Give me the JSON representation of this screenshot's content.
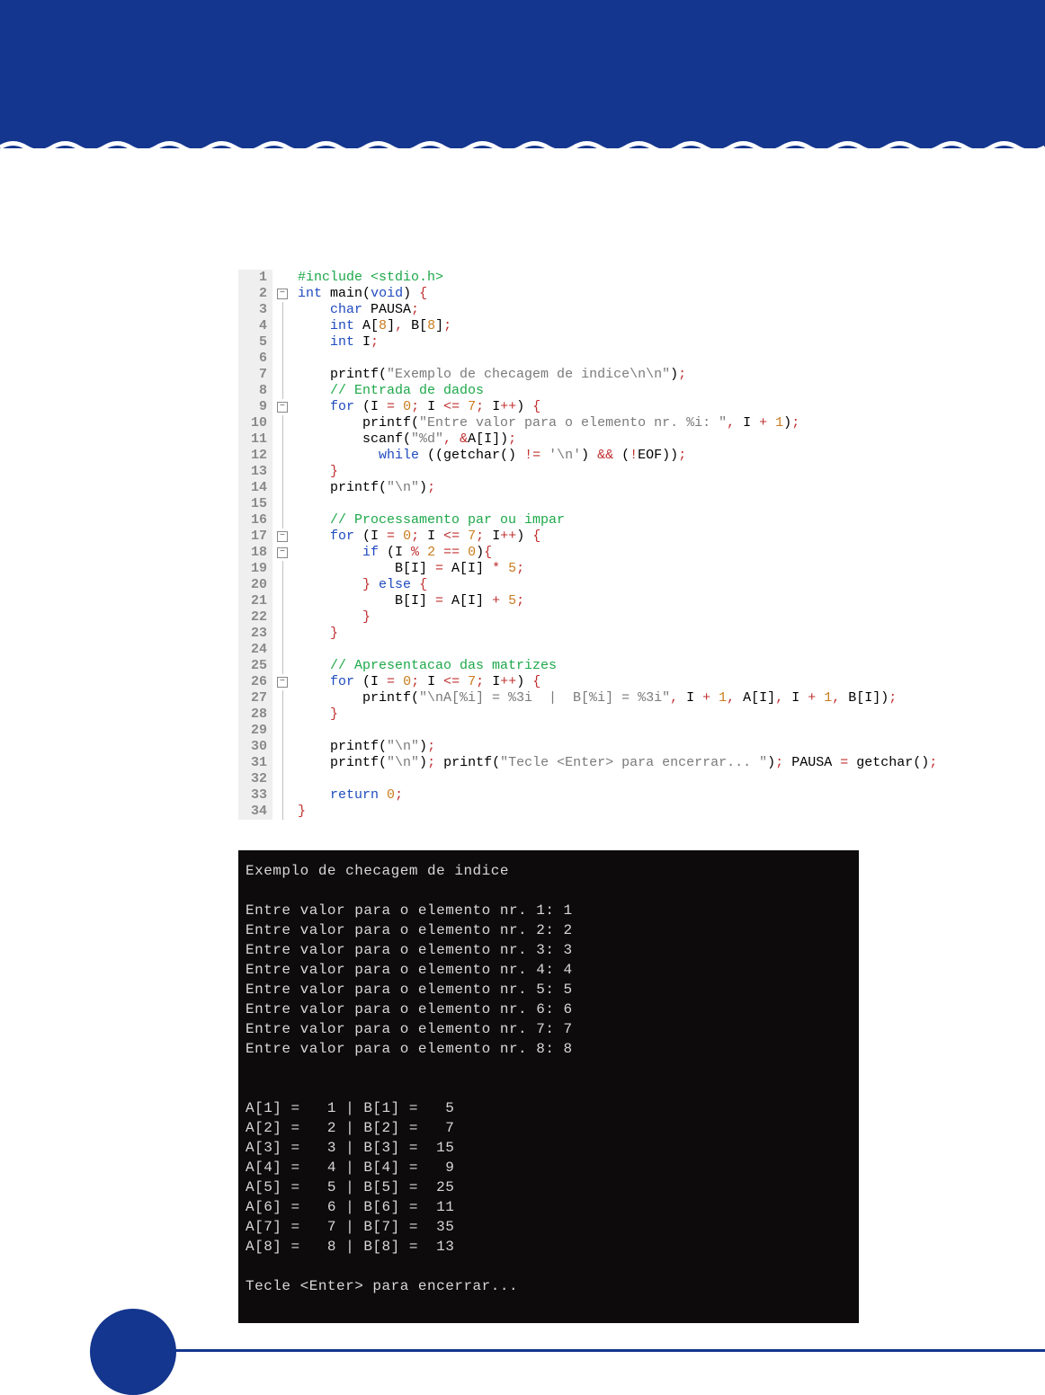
{
  "code_lines": [
    {
      "n": 1,
      "fold": "",
      "html": "<span class='c-pp'>#include &lt;stdio.h&gt;</span>"
    },
    {
      "n": 2,
      "fold": "box",
      "html": "<span class='c-kw'>int</span> <span class='c-fn'>main</span>(<span class='c-kw'>void</span>) <span class='c-op'>{</span>"
    },
    {
      "n": 3,
      "fold": "pipe",
      "html": "    <span class='c-kw'>char</span> PAUSA<span class='c-op'>;</span>"
    },
    {
      "n": 4,
      "fold": "pipe",
      "html": "    <span class='c-kw'>int</span> A[<span class='c-num'>8</span>]<span class='c-op'>,</span> B[<span class='c-num'>8</span>]<span class='c-op'>;</span>"
    },
    {
      "n": 5,
      "fold": "pipe",
      "html": "    <span class='c-kw'>int</span> I<span class='c-op'>;</span>"
    },
    {
      "n": 6,
      "fold": "pipe",
      "html": ""
    },
    {
      "n": 7,
      "fold": "pipe",
      "html": "    printf(<span class='c-str'>\"Exemplo de checagem de indice\\n\\n\"</span>)<span class='c-op'>;</span>"
    },
    {
      "n": 8,
      "fold": "pipe",
      "html": "    <span class='c-cm'>// Entrada de dados</span>"
    },
    {
      "n": 9,
      "fold": "box",
      "html": "    <span class='c-kw'>for</span> (I <span class='c-op'>=</span> <span class='c-num'>0</span><span class='c-op'>;</span> I <span class='c-op'>&lt;=</span> <span class='c-num'>7</span><span class='c-op'>;</span> I<span class='c-op'>++</span>) <span class='c-op'>{</span>"
    },
    {
      "n": 10,
      "fold": "pipe",
      "html": "        printf(<span class='c-str'>\"Entre valor para o elemento nr. %i: \"</span><span class='c-op'>,</span> I <span class='c-op'>+</span> <span class='c-num'>1</span>)<span class='c-op'>;</span>"
    },
    {
      "n": 11,
      "fold": "pipe",
      "html": "        scanf(<span class='c-str'>\"%d\"</span><span class='c-op'>,</span> <span class='c-op'>&amp;</span>A[I])<span class='c-op'>;</span>"
    },
    {
      "n": 12,
      "fold": "pipe",
      "html": "          <span class='c-kw'>while</span> ((getchar() <span class='c-op'>!=</span> <span class='c-str'>'\\n'</span>) <span class='c-op'>&amp;&amp;</span> (<span class='c-op'>!</span>EOF))<span class='c-op'>;</span>"
    },
    {
      "n": 13,
      "fold": "pipe",
      "html": "    <span class='c-op'>}</span>"
    },
    {
      "n": 14,
      "fold": "pipe",
      "html": "    printf(<span class='c-str'>\"\\n\"</span>)<span class='c-op'>;</span>"
    },
    {
      "n": 15,
      "fold": "pipe",
      "html": ""
    },
    {
      "n": 16,
      "fold": "pipe",
      "html": "    <span class='c-cm'>// Processamento par ou impar</span>"
    },
    {
      "n": 17,
      "fold": "box",
      "html": "    <span class='c-kw'>for</span> (I <span class='c-op'>=</span> <span class='c-num'>0</span><span class='c-op'>;</span> I <span class='c-op'>&lt;=</span> <span class='c-num'>7</span><span class='c-op'>;</span> I<span class='c-op'>++</span>) <span class='c-op'>{</span>"
    },
    {
      "n": 18,
      "fold": "box",
      "html": "        <span class='c-kw'>if</span> (I <span class='c-op'>%</span> <span class='c-num'>2</span> <span class='c-op'>==</span> <span class='c-num'>0</span>)<span class='c-op'>{</span>"
    },
    {
      "n": 19,
      "fold": "pipe",
      "html": "            B[I] <span class='c-op'>=</span> A[I] <span class='c-op'>*</span> <span class='c-num'>5</span><span class='c-op'>;</span>"
    },
    {
      "n": 20,
      "fold": "pipe",
      "html": "        <span class='c-op'>}</span> <span class='c-kw'>else</span> <span class='c-op'>{</span>"
    },
    {
      "n": 21,
      "fold": "pipe",
      "html": "            B[I] <span class='c-op'>=</span> A[I] <span class='c-op'>+</span> <span class='c-num'>5</span><span class='c-op'>;</span>"
    },
    {
      "n": 22,
      "fold": "pipe",
      "html": "        <span class='c-op'>}</span>"
    },
    {
      "n": 23,
      "fold": "pipe",
      "html": "    <span class='c-op'>}</span>"
    },
    {
      "n": 24,
      "fold": "pipe",
      "html": ""
    },
    {
      "n": 25,
      "fold": "pipe",
      "html": "    <span class='c-cm'>// Apresentacao das matrizes</span>"
    },
    {
      "n": 26,
      "fold": "box",
      "html": "    <span class='c-kw'>for</span> (I <span class='c-op'>=</span> <span class='c-num'>0</span><span class='c-op'>;</span> I <span class='c-op'>&lt;=</span> <span class='c-num'>7</span><span class='c-op'>;</span> I<span class='c-op'>++</span>) <span class='c-op'>{</span>"
    },
    {
      "n": 27,
      "fold": "pipe",
      "html": "        printf(<span class='c-str'>\"\\nA[%i] = %3i  |  B[%i] = %3i\"</span><span class='c-op'>,</span> I <span class='c-op'>+</span> <span class='c-num'>1</span><span class='c-op'>,</span> A[I]<span class='c-op'>,</span> I <span class='c-op'>+</span> <span class='c-num'>1</span><span class='c-op'>,</span> B[I])<span class='c-op'>;</span>"
    },
    {
      "n": 28,
      "fold": "pipe",
      "html": "    <span class='c-op'>}</span>"
    },
    {
      "n": 29,
      "fold": "pipe",
      "html": ""
    },
    {
      "n": 30,
      "fold": "pipe",
      "html": "    printf(<span class='c-str'>\"\\n\"</span>)<span class='c-op'>;</span>"
    },
    {
      "n": 31,
      "fold": "pipe",
      "html": "    printf(<span class='c-str'>\"\\n\"</span>)<span class='c-op'>;</span> printf(<span class='c-str'>\"Tecle &lt;Enter&gt; para encerrar... \"</span>)<span class='c-op'>;</span> PAUSA <span class='c-op'>=</span> getchar()<span class='c-op'>;</span>"
    },
    {
      "n": 32,
      "fold": "pipe",
      "html": ""
    },
    {
      "n": 33,
      "fold": "pipe",
      "html": "    <span class='c-kw'>return</span> <span class='c-num'>0</span><span class='c-op'>;</span>"
    },
    {
      "n": 34,
      "fold": "pipe",
      "html": "<span class='c-op'>}</span>"
    }
  ],
  "terminal_lines": [
    "Exemplo de checagem de indice",
    "",
    "Entre valor para o elemento nr. 1: 1",
    "Entre valor para o elemento nr. 2: 2",
    "Entre valor para o elemento nr. 3: 3",
    "Entre valor para o elemento nr. 4: 4",
    "Entre valor para o elemento nr. 5: 5",
    "Entre valor para o elemento nr. 6: 6",
    "Entre valor para o elemento nr. 7: 7",
    "Entre valor para o elemento nr. 8: 8",
    "",
    "",
    "A[1] =   1 | B[1] =   5",
    "A[2] =   2 | B[2] =   7",
    "A[3] =   3 | B[3] =  15",
    "A[4] =   4 | B[4] =   9",
    "A[5] =   5 | B[5] =  25",
    "A[6] =   6 | B[6] =  11",
    "A[7] =   7 | B[7] =  35",
    "A[8] =   8 | B[8] =  13",
    "",
    "Tecle <Enter> para encerrar..."
  ]
}
